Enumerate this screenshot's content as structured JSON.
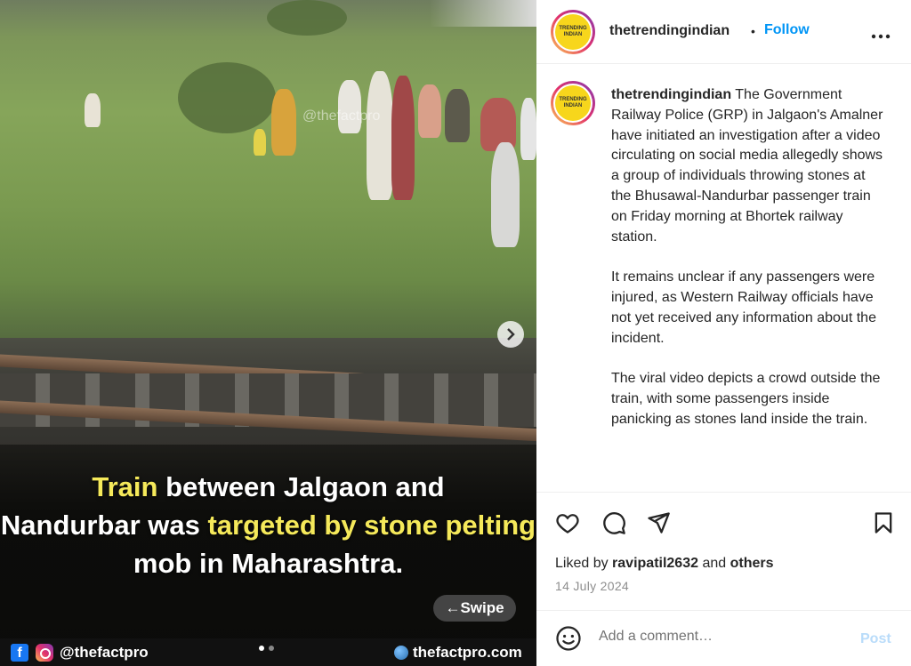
{
  "media": {
    "watermark": "@thefactpro",
    "caption_parts": [
      {
        "text": "Train",
        "highlight": true
      },
      {
        "text": " between Jalgaon and ",
        "highlight": false
      },
      {
        "text": "Nandurbar was ",
        "highlight": false
      },
      {
        "text": "targeted by stone pelting",
        "highlight": true
      },
      {
        "text": " mob in Maharashtra.",
        "highlight": false
      }
    ],
    "swipe_label": "←Swipe",
    "footer_handle": "@thefactpro",
    "footer_site": "thefactpro.com",
    "carousel": {
      "total": 2,
      "current": 1
    },
    "caption_highlight_color": "#f5e95a"
  },
  "header": {
    "username": "thetrendingindian",
    "separator": "•",
    "follow_label": "Follow",
    "more_label": "•••",
    "avatar_text": "TRENDING INDIAN"
  },
  "post": {
    "username": "thetrendingindian",
    "paragraphs": [
      "The Government Railway Police (GRP) in Jalgaon's Amalner have initiated an investigation after a video circulating on social media allegedly shows a group of individuals throwing stones at the Bhusawal-Nandurbar passenger train on Friday morning at Bhortek railway station.",
      "It remains unclear if any passengers were injured, as Western Railway officials have not yet received any information about the incident.",
      "The viral video depicts a crowd outside the train, with some passengers inside panicking as stones land inside the train."
    ]
  },
  "actions": {
    "icons": [
      "heart-icon",
      "comment-icon",
      "share-icon",
      "bookmark-icon"
    ]
  },
  "likes": {
    "prefix": "Liked by ",
    "user": "ravipatil2632",
    "middle": " and ",
    "others": "others"
  },
  "date": "14 July 2024",
  "comment": {
    "placeholder": "Add a comment…",
    "post_label": "Post"
  },
  "colors": {
    "follow": "#0095f6",
    "post_disabled": "#b9dcfa"
  }
}
